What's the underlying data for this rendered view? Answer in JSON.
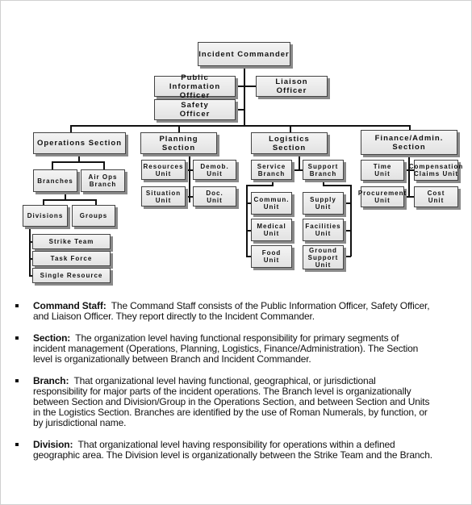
{
  "org_chart": {
    "incident_commander": "Incident Commander",
    "public_information_officer": "Public Information\nOfficer",
    "liaison_officer": "Liaison\nOfficer",
    "safety_officer": "Safety\nOfficer",
    "operations": {
      "title": "Operations Section",
      "branches": "Branches",
      "air_ops_branch": "Air Ops\nBranch",
      "divisions": "Divisions",
      "groups": "Groups",
      "strike_team": "Strike Team",
      "task_force": "Task Force",
      "single_resource": "Single Resource"
    },
    "planning": {
      "title": "Planning Section",
      "resources_unit": "Resources\nUnit",
      "demob_unit": "Demob.\nUnit",
      "situation_unit": "Situation\nUnit",
      "doc_unit": "Doc.\nUnit"
    },
    "logistics": {
      "title": "Logistics Section",
      "service_branch": "Service\nBranch",
      "support_branch": "Support\nBranch",
      "commun_unit": "Commun.\nUnit",
      "medical_unit": "Medical\nUnit",
      "food_unit": "Food\nUnit",
      "supply_unit": "Supply\nUnit",
      "facilities_unit": "Facilities\nUnit",
      "ground_support_unit": "Ground\nSupport\nUnit"
    },
    "finance": {
      "title": "Finance/Admin.\nSection",
      "time_unit": "Time\nUnit",
      "compensation_claims_unit": "Compensation\nClaims Unit",
      "procurement_unit": "Procurement\nUnit",
      "cost_unit": "Cost\nUnit"
    }
  },
  "definitions": [
    {
      "term": "Command Staff:",
      "text": "The Command Staff consists of the Public Information Officer, Safety Officer, and Liaison Officer.  They report directly to the Incident Commander."
    },
    {
      "term": "Section:",
      "text": "The organization level having functional responsibility for primary segments of incident management (Operations, Planning, Logistics, Finance/Administration).  The Section level is organizationally between Branch and Incident Commander."
    },
    {
      "term": "Branch:",
      "text": "That organizational level having functional, geographical, or jurisdictional responsibility for major parts of the incident operations.  The Branch level is organizationally between Section and Division/Group in the Operations Section, and between Section and Units in the Logistics Section.  Branches are identified by the use of Roman Numerals, by function, or by jurisdictional name."
    },
    {
      "term": "Division:",
      "text": "That organizational level having responsibility for operations within a defined geographic area.  The Division level is organizationally between the Strike Team and the Branch."
    }
  ]
}
